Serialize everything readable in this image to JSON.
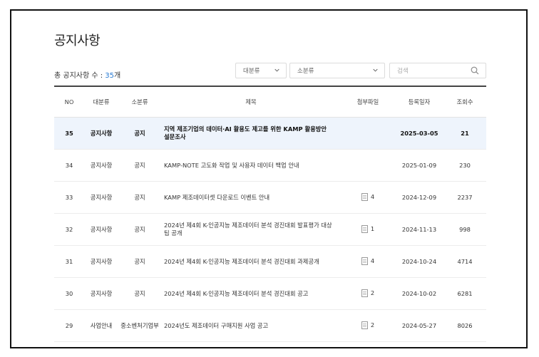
{
  "page": {
    "title": "공지사항",
    "count_label": "총 공지사항 수 : ",
    "count_value": "35",
    "count_suffix": "개"
  },
  "filters": {
    "major": "대분류",
    "minor": "소분류",
    "search_placeholder": "검색"
  },
  "table": {
    "headers": [
      "NO",
      "대분류",
      "소분류",
      "제목",
      "첨부파일",
      "등록일자",
      "조회수"
    ],
    "rows": [
      {
        "no": "35",
        "major": "공지사항",
        "minor": "공지",
        "title": "지역 제조기업의 데이터·AI 활용도 제고를 위한 KAMP 활용방안 설문조사",
        "attach": "",
        "date": "2025-03-05",
        "views": "21",
        "highlight": true
      },
      {
        "no": "34",
        "major": "공지사항",
        "minor": "공지",
        "title": "KAMP-NOTE 고도화 작업 및 사용자 데이터 백업 안내",
        "attach": "",
        "date": "2025-01-09",
        "views": "230"
      },
      {
        "no": "33",
        "major": "공지사항",
        "minor": "공지",
        "title": "KAMP 제조데이터셋 다운로드 이벤트 안내",
        "attach": "4",
        "date": "2024-12-09",
        "views": "2237"
      },
      {
        "no": "32",
        "major": "공지사항",
        "minor": "공지",
        "title": "2024년 제4회 K-인공지능 제조데이터 분석 경진대회 발표평가 대상팀 공개",
        "attach": "1",
        "date": "2024-11-13",
        "views": "998"
      },
      {
        "no": "31",
        "major": "공지사항",
        "minor": "공지",
        "title": "2024년 제4회 K-인공지능 제조데이터 분석 경진대회 과제공개",
        "attach": "4",
        "date": "2024-10-24",
        "views": "4714"
      },
      {
        "no": "30",
        "major": "공지사항",
        "minor": "공지",
        "title": "2024년 제4회 K-인공지능 제조데이터 분석 경진대회 공고",
        "attach": "2",
        "date": "2024-10-02",
        "views": "6281"
      },
      {
        "no": "29",
        "major": "사업안내",
        "minor": "중소벤처기업부",
        "title": "2024년도 제조데이터 구매지원 사업 공고",
        "attach": "2",
        "date": "2024-05-27",
        "views": "8026"
      }
    ]
  },
  "icons": {
    "attachment": "document-icon",
    "search": "search-icon",
    "dropdown": "chevron-down-icon"
  }
}
